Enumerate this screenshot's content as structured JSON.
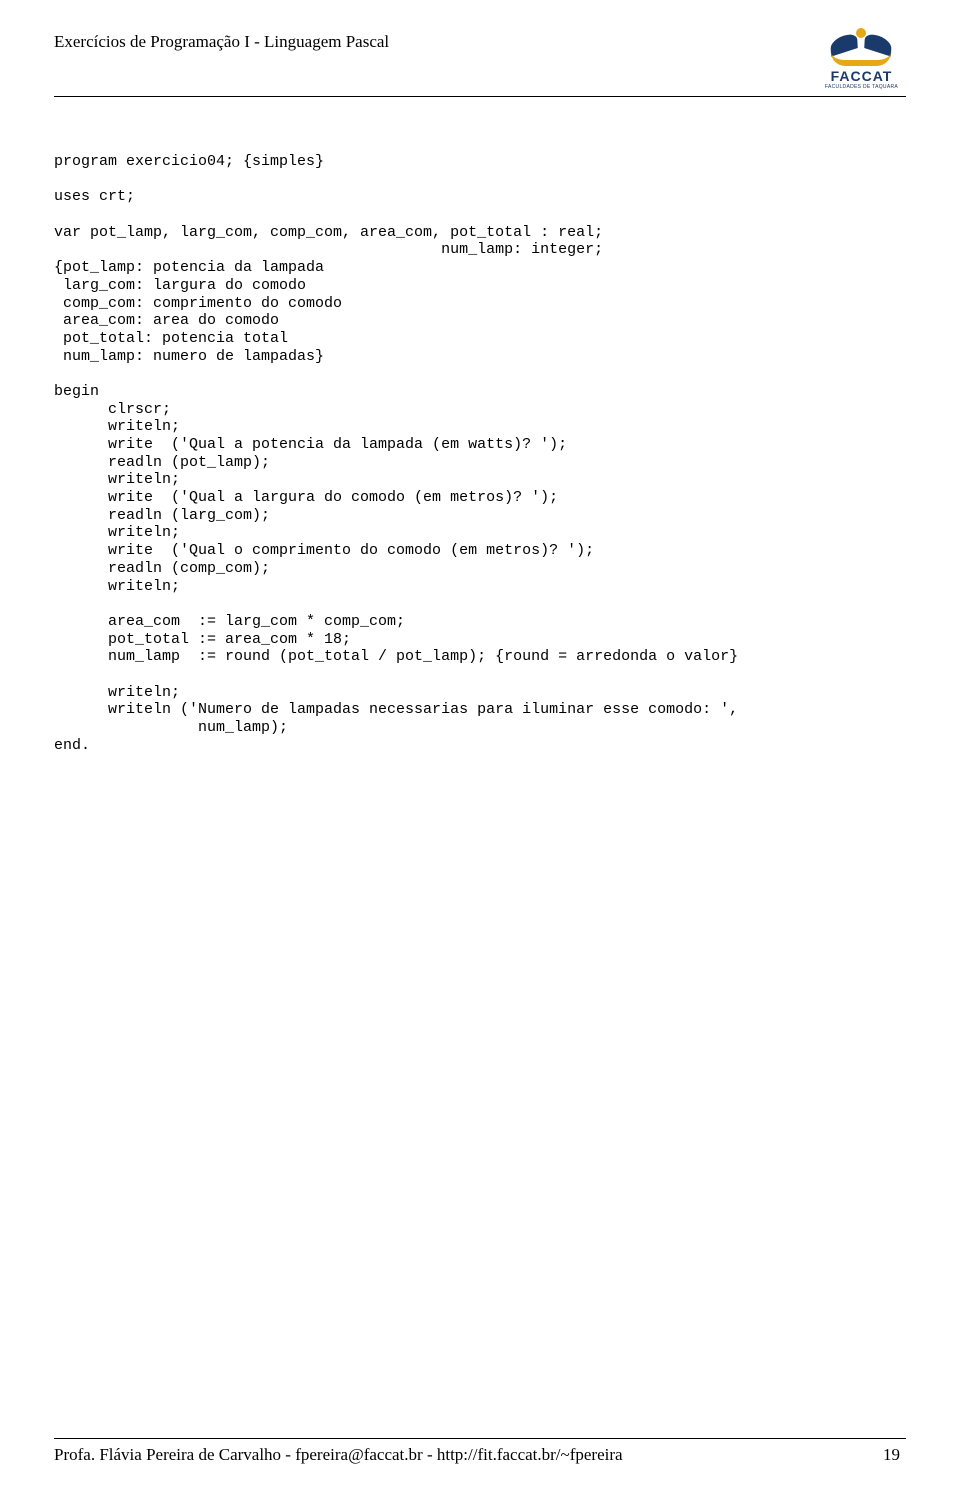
{
  "header": {
    "title": "Exercícios de Programação I - Linguagem Pascal",
    "logo_name": "FACCAT",
    "logo_sub": "FACULDADES DE TAQUARA"
  },
  "code": {
    "l01": "program exercicio04; {simples}",
    "l02": "",
    "l03": "uses crt;",
    "l04": "",
    "l05": "var pot_lamp, larg_com, comp_com, area_com, pot_total : real;",
    "l06": "                                           num_lamp: integer;",
    "l07": "{pot_lamp: potencia da lampada",
    "l08": " larg_com: largura do comodo",
    "l09": " comp_com: comprimento do comodo",
    "l10": " area_com: area do comodo",
    "l11": " pot_total: potencia total",
    "l12": " num_lamp: numero de lampadas}",
    "l13": "",
    "l14": "begin",
    "l15": "      clrscr;",
    "l16": "      writeln;",
    "l17": "      write  ('Qual a potencia da lampada (em watts)? ');",
    "l18": "      readln (pot_lamp);",
    "l19": "      writeln;",
    "l20": "      write  ('Qual a largura do comodo (em metros)? ');",
    "l21": "      readln (larg_com);",
    "l22": "      writeln;",
    "l23": "      write  ('Qual o comprimento do comodo (em metros)? ');",
    "l24": "      readln (comp_com);",
    "l25": "      writeln;",
    "l26": "",
    "l27": "      area_com  := larg_com * comp_com;",
    "l28": "      pot_total := area_com * 18;",
    "l29": "      num_lamp  := round (pot_total / pot_lamp); {round = arredonda o valor}",
    "l30": "",
    "l31": "      writeln;",
    "l32": "      writeln ('Numero de lampadas necessarias para iluminar esse comodo: ',",
    "l33": "                num_lamp);",
    "l34": "end."
  },
  "footer": {
    "text": "Profa. Flávia Pereira de Carvalho - fpereira@faccat.br - http://fit.faccat.br/~fpereira",
    "page": "19"
  }
}
